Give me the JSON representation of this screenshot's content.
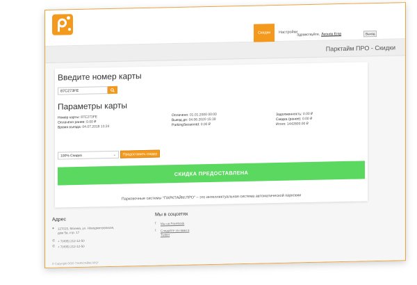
{
  "header": {
    "nav": [
      {
        "label": "Скидки",
        "active": true
      },
      {
        "label": "Настройки",
        "active": false
      }
    ],
    "greeting": "Здравствуйте,",
    "user": "Леонов Егор",
    "logout_label": "Выход"
  },
  "page_title": "Парктайм ПРО - Скидки",
  "main": {
    "card_heading": "Введите номер карты",
    "card_value": "87C273FE",
    "params_heading": "Параметры карты",
    "col1": [
      {
        "label": "Номер карты:",
        "value": "87C273FE"
      },
      {
        "label": "Оплачено ранее:",
        "value": "0.00 ₽"
      },
      {
        "label": "Время въезда:",
        "value": "04.07.2018 13:24"
      }
    ],
    "col2": [
      {
        "label": "Оплачено:",
        "value": "01.01.2000 00:00"
      },
      {
        "label": "Выезд до:",
        "value": "04.06.2020 15:39"
      },
      {
        "label": "ParkingSessionId:",
        "value": "0.00 ₽"
      }
    ],
    "col3": [
      {
        "label": "Задолженность:",
        "value": "0.00 ₽"
      },
      {
        "label": "Скидка (ранее):",
        "value": "0.00 ₽"
      },
      {
        "label": "Итого:",
        "value": "1442800.00 ₽"
      }
    ],
    "discount_selected": "100% Скидка",
    "apply_label": "Предоставить скидку",
    "status_button": "СКИДКА ПРЕДОСТАВЛЕНА",
    "tagline": "Парковочные системы \"ПАРКТАЙМ.ПРО\" – это интеллектуальная система автоматической парковки"
  },
  "footer": {
    "address_heading": "Адрес",
    "address_line1": "127015, Москва, ул. Новодмитровская,",
    "address_line2": "дом 5а, стр. 17",
    "phone1": "+ 7(495) 212-12-50",
    "phone2": "+ 7(495) 212-12-50",
    "social_heading": "Мы в соцсетях",
    "facebook": "Мы на Facebook",
    "twitter_line1": "Следуйте за нами в",
    "twitter_line2": "Twitter",
    "copyright": "© Copyright ООО \"ПАРКТАЙМ.ПРО\""
  },
  "colors": {
    "accent": "#f39a1e",
    "success": "#5ad85f",
    "border_highlight": "#e9a43a"
  }
}
